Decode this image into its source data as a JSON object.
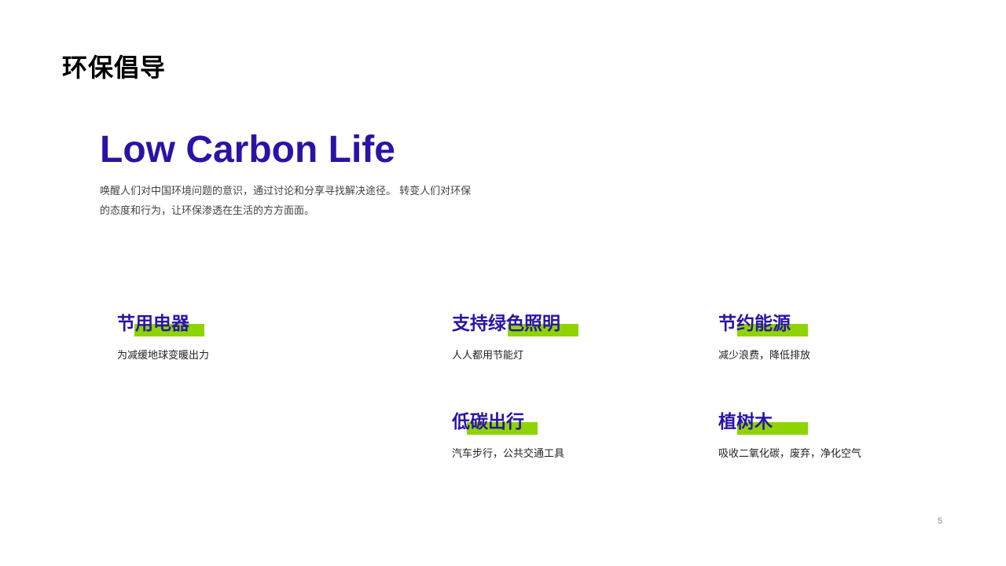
{
  "slide": {
    "title": "环保倡导",
    "page_number": "5"
  },
  "hero": {
    "heading": "Low Carbon Life",
    "description": "唤醒人们对中国环境问题的意识，通过讨论和分享寻找解决途径。 转变人们对环保的态度和行为，让环保渗透在生活的方方面面。"
  },
  "colors": {
    "primary": "#2a14a6",
    "accent": "#8fd400",
    "text_dark": "#222222",
    "text_muted": "#444444"
  },
  "cards": [
    {
      "title": "节用电器",
      "subtitle": "为减缓地球变暖出力"
    },
    {
      "title": "支持绿色照明",
      "subtitle": "人人都用节能灯"
    },
    {
      "title": "节约能源",
      "subtitle": "减少浪费，降低排放"
    },
    {
      "title": "低碳出行",
      "subtitle": "汽车步行，公共交通工具"
    },
    {
      "title": "植树木",
      "subtitle": "吸收二氧化碳，废弃，净化空气"
    }
  ]
}
